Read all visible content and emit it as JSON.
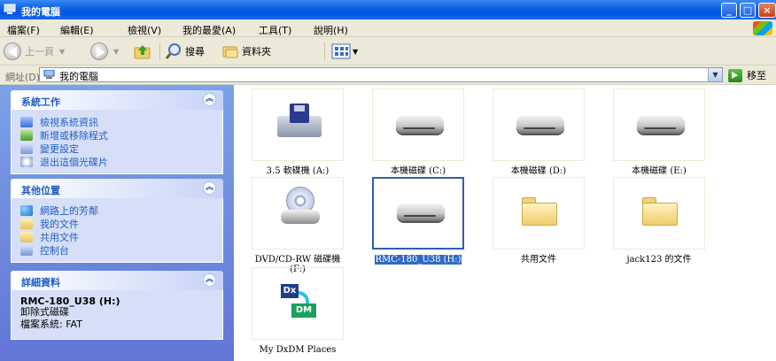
{
  "window": {
    "title": "我的電腦",
    "controls": {
      "minimize": "_",
      "maximize": "□",
      "close": "×"
    }
  },
  "menu": [
    "檔案(F)",
    "編輯(E)",
    "檢視(V)",
    "我的最愛(A)",
    "工具(T)",
    "說明(H)"
  ],
  "toolbar": {
    "back": "上一頁",
    "search": "搜尋",
    "folders": "資料夾"
  },
  "address": {
    "label": "網址(D)",
    "value": "我的電腦",
    "go": "移至"
  },
  "panels": {
    "system": {
      "title": "系統工作",
      "items": [
        "檢視系統資訊",
        "新增或移除程式",
        "變更設定",
        "退出這個光碟片"
      ]
    },
    "other": {
      "title": "其他位置",
      "items": [
        "網路上的芳鄰",
        "我的文件",
        "共用文件",
        "控制台"
      ]
    },
    "details": {
      "title": "詳細資料",
      "name": "RMC-180_U38 (H:)",
      "type": "卸除式磁碟",
      "fs": "檔案系統: FAT"
    }
  },
  "items": [
    {
      "label": "3.5 軟碟機 (A:)",
      "icon": "floppy-drive-icon"
    },
    {
      "label": "本機磁碟 (C:)",
      "icon": "hard-drive-icon"
    },
    {
      "label": "本機磁碟 (D:)",
      "icon": "hard-drive-icon"
    },
    {
      "label": "本機磁碟 (E:)",
      "icon": "hard-drive-icon"
    },
    {
      "label": "DVD/CD-RW 磁碟機",
      "label2": "(F:)",
      "icon": "cd-drive-icon"
    },
    {
      "label": "RMC-180_U38 (H:)",
      "icon": "removable-drive-icon",
      "selected": true
    },
    {
      "label": "共用文件",
      "icon": "folder-icon"
    },
    {
      "label": "jack123 的文件",
      "icon": "folder-icon"
    },
    {
      "label": "My DxDM Places",
      "icon": "dxdm-icon"
    }
  ],
  "colors": {
    "titlebar": "#0a5ee0",
    "taskpane": "#6f8fe0",
    "link": "#215dc6",
    "selection": "#316ac5"
  }
}
